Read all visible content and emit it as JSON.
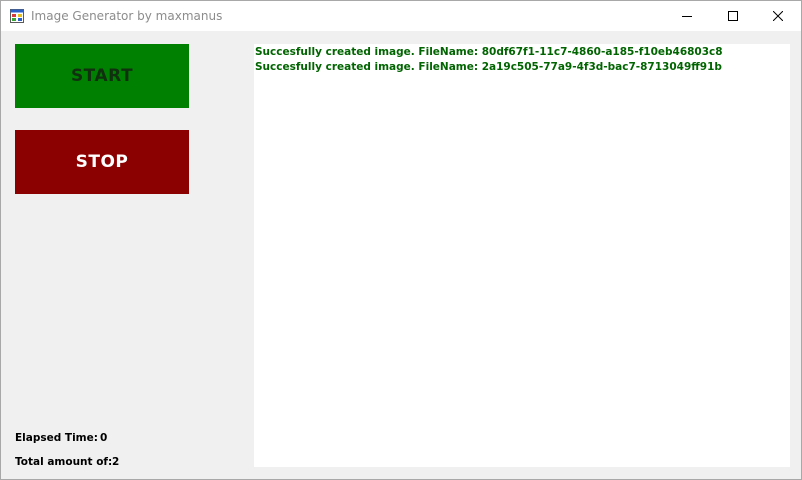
{
  "window": {
    "title": "Image Generator by maxmanus",
    "controls": {
      "minimize_icon": "minimize-icon",
      "maximize_icon": "maximize-icon",
      "close_icon": "close-icon"
    }
  },
  "buttons": {
    "start_label": "START",
    "stop_label": "STOP"
  },
  "log": {
    "lines": [
      "Succesfully created image. FileName: 80df67f1-11c7-4860-a185-f10eb46803c8",
      "Succesfully created image. FileName: 2a19c505-77a9-4f3d-bac7-8713049ff91b"
    ]
  },
  "stats": {
    "elapsed_label": "Elapsed Time:",
    "elapsed_value": "0",
    "total_label": "Total amount of:",
    "total_value": "2"
  },
  "colors": {
    "start_bg": "#008000",
    "stop_bg": "#8b0000",
    "log_text": "#006400",
    "window_bg": "#f0f0f0"
  }
}
